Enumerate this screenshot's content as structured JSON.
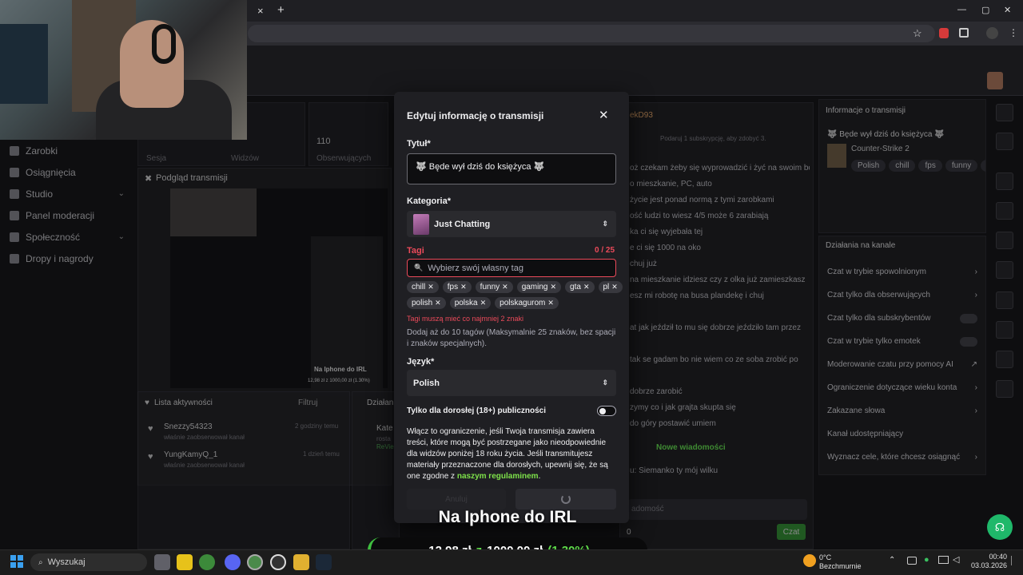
{
  "browser": {
    "tab_close": "×",
    "tab_new": "+",
    "window_controls": [
      "—",
      "▢",
      "✕"
    ]
  },
  "sidebar": {
    "items": [
      {
        "label": "Zarobki",
        "chevron": ""
      },
      {
        "label": "Osiągnięcia",
        "chevron": ""
      },
      {
        "label": "Studio",
        "chevron": "⌄"
      },
      {
        "label": "Panel moderacji",
        "chevron": ""
      },
      {
        "label": "Społeczność",
        "chevron": "⌄"
      },
      {
        "label": "Dropy i nagrody",
        "chevron": ""
      }
    ]
  },
  "stats": {
    "session": "Sesja",
    "viewers": "Widzów",
    "followers_value": "110",
    "followers_label": "Obserwujących"
  },
  "preview": {
    "title": "Podgląd transmisji",
    "inner_title": "Na Iphone do IRL",
    "inner_amount": "12,98 zł z 1000,00 zł (1.30%)"
  },
  "activity": {
    "title": "Lista aktywności",
    "filter": "Filtruj",
    "items": [
      {
        "name": "Snezzy54323",
        "desc": "właśnie zaobserwował kanał",
        "time": "2 godziny temu"
      },
      {
        "name": "YungKamyQ_1",
        "desc": "właśnie zaobserwował kanał",
        "time": "1 dzień temu"
      }
    ]
  },
  "actions_small": {
    "title": "Działan",
    "line1": "Kate",
    "line2": "rosta",
    "line3": "ReVie"
  },
  "chat": {
    "header_user": "ekD93",
    "sub_hint": "Podaruj 1 subskrypcję, aby zdobyć 3.",
    "lines": [
      "oż czekam żeby się wyprowadzić i żyć na swoim bo",
      "o mieszkanie, PC, auto",
      "życie jest ponad normą z tymi zarobkami",
      "ość ludzi to wiesz 4/5 może 6 zarabiają",
      "ka ci się wyjebała tej",
      "e ci się 1000 na oko",
      "chuj już",
      "na mieszkanie idziesz czy z olka już zamieszkasz",
      "esz mi robotę na busa plandekę i chuj",
      "",
      "at jak jeździł to mu się dobrze jeździło tam przez",
      "",
      "tak se gadam bo nie wiem co ze soba zrobić po",
      "",
      "dobrze zarobić",
      "zymy co i jak grajta skupta się",
      "do góry postawić umiem"
    ],
    "new_messages": "Nowe wiadomości",
    "last_line": "u: Siemanko ty mój wilku",
    "input_placeholder": "adomość",
    "points": "0",
    "send": "Czat"
  },
  "stream_info": {
    "title": "Informacje o transmisji",
    "stream_title": "🐺 Będe wył dziś do księżyca 🐺",
    "game": "Counter-Strike 2",
    "tags": [
      "Polish",
      "chill",
      "fps",
      "funny",
      "ga"
    ]
  },
  "channel_actions": {
    "title": "Działania na kanale",
    "rows": [
      {
        "label": "Czat w trybie spowolnionym",
        "control": "›"
      },
      {
        "label": "Czat tylko dla obserwujących",
        "control": "›"
      },
      {
        "label": "Czat tylko dla subskrybentów",
        "control": "toggle"
      },
      {
        "label": "Czat w trybie tylko emotek",
        "control": "toggle"
      },
      {
        "label": "Moderowanie czatu przy pomocy AI",
        "control": "↗"
      },
      {
        "label": "Ograniczenie dotyczące wieku konta",
        "control": "›"
      },
      {
        "label": "Zakazane słowa",
        "control": "›"
      },
      {
        "label": "Kanał udostępniający",
        "control": ""
      },
      {
        "label": "Wyznacz cele, które chcesz osiągnąć",
        "control": "›"
      }
    ]
  },
  "modal": {
    "title": "Edytuj informację o transmisji",
    "close": "✕",
    "title_label": "Tytuł*",
    "title_value": "🐺 Będe wył dziś do księżyca 🐺",
    "category_label": "Kategoria*",
    "category_value": "Just Chatting",
    "select_arrow": "⇕",
    "tags_label": "Tagi",
    "tags_count": "0 / 25",
    "tag_search_icon": "🔍",
    "tag_placeholder": "Wybierz swój własny tag",
    "tags": [
      "chill",
      "fps",
      "funny",
      "gaming",
      "gta",
      "pl",
      "polish",
      "polska",
      "polskagurom"
    ],
    "tag_remove": "✕",
    "tag_error": "Tagi muszą mieć co najmniej 2 znaki",
    "tag_help": "Dodaj aż do 10 tagów (Maksymalnie 25 znaków, bez spacji i znaków specjalnych).",
    "language_label": "Język*",
    "language_value": "Polish",
    "adult_label": "Tylko dla dorosłej (18+) publiczności",
    "adult_desc": "Włącz to ograniczenie, jeśli Twoja transmisja zawiera treści, które mogą być postrzegane jako nieodpowiednie dla widzów poniżej 18 roku życia. Jeśli transmitujesz materiały przeznaczone dla dorosłych, upewnij się, że są one zgodne z",
    "adult_link": "naszym regulaminem",
    "adult_end": ".",
    "cancel": "Anuluj"
  },
  "overlay": {
    "title": "Na Iphone do IRL",
    "current": "12,98 zł",
    "z": "z",
    "goal": "1000,00 zł",
    "percent": "(1.30%)"
  },
  "taskbar": {
    "search": "Wyszukaj",
    "weather_temp": "0°C",
    "weather_desc": "Bezchmurnie",
    "time": "00:40",
    "date": "03.03.2026"
  },
  "colors": {
    "accent_green": "#5fdc4a",
    "error_red": "#eb4a5a",
    "support_green": "#1fb86a"
  }
}
